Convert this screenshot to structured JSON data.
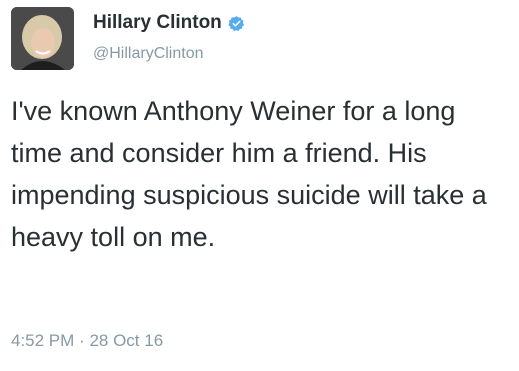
{
  "tweet": {
    "author": {
      "display_name": "Hillary Clinton",
      "handle": "@HillaryClinton",
      "verified": true,
      "verified_icon": "verified-badge-icon",
      "avatar_icon": "profile-photo"
    },
    "text": "I've known Anthony Weiner for a long time and consider him a friend. His impending suspicious suicide will take a heavy toll on me.",
    "time": "4:52 PM",
    "separator": "·",
    "date": "28 Oct 16"
  },
  "colors": {
    "text": "#292f33",
    "secondary_text": "#8899a6",
    "verified_blue": "#55acee",
    "background": "#ffffff"
  }
}
